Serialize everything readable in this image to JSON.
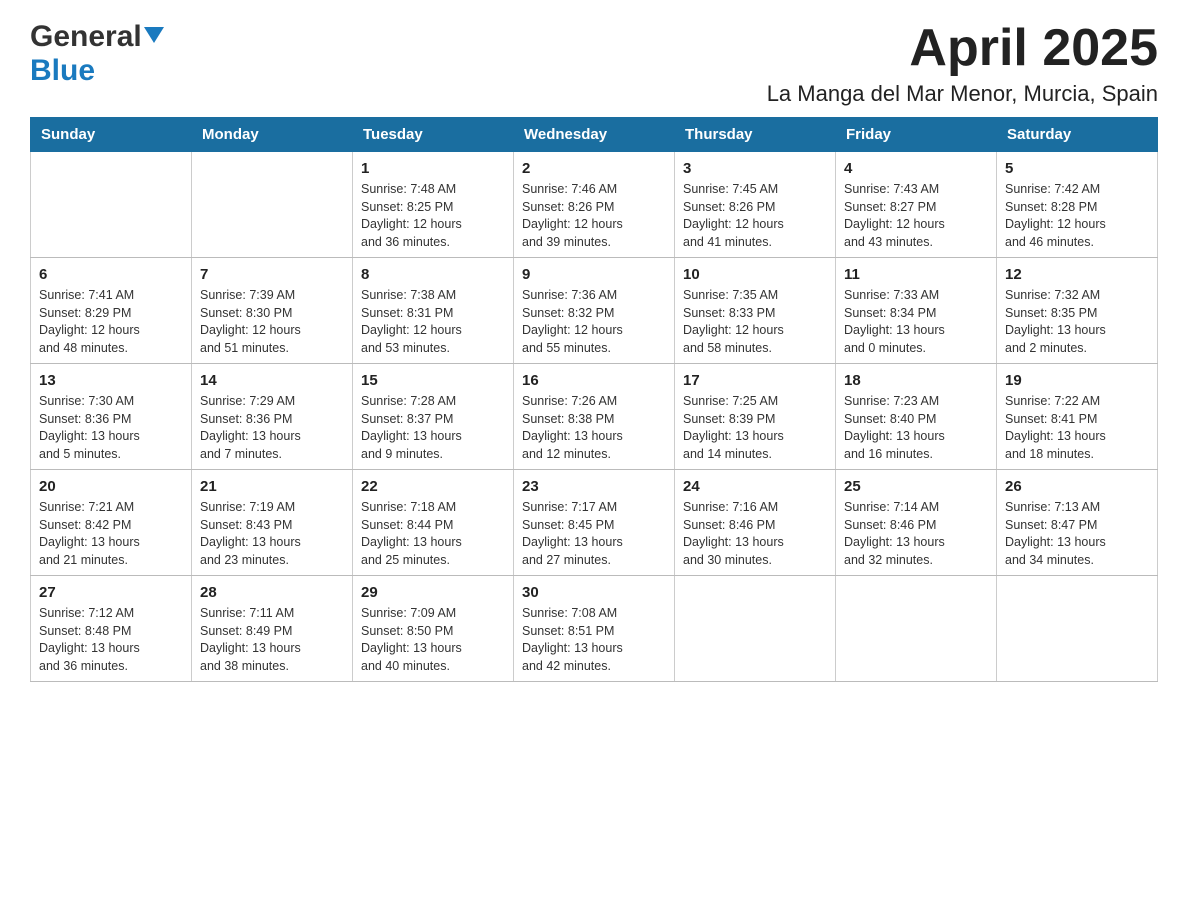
{
  "logo": {
    "general": "General",
    "blue": "Blue"
  },
  "title": "April 2025",
  "subtitle": "La Manga del Mar Menor, Murcia, Spain",
  "weekdays": [
    "Sunday",
    "Monday",
    "Tuesday",
    "Wednesday",
    "Thursday",
    "Friday",
    "Saturday"
  ],
  "rows": [
    [
      {
        "day": "",
        "info": ""
      },
      {
        "day": "",
        "info": ""
      },
      {
        "day": "1",
        "info": "Sunrise: 7:48 AM\nSunset: 8:25 PM\nDaylight: 12 hours\nand 36 minutes."
      },
      {
        "day": "2",
        "info": "Sunrise: 7:46 AM\nSunset: 8:26 PM\nDaylight: 12 hours\nand 39 minutes."
      },
      {
        "day": "3",
        "info": "Sunrise: 7:45 AM\nSunset: 8:26 PM\nDaylight: 12 hours\nand 41 minutes."
      },
      {
        "day": "4",
        "info": "Sunrise: 7:43 AM\nSunset: 8:27 PM\nDaylight: 12 hours\nand 43 minutes."
      },
      {
        "day": "5",
        "info": "Sunrise: 7:42 AM\nSunset: 8:28 PM\nDaylight: 12 hours\nand 46 minutes."
      }
    ],
    [
      {
        "day": "6",
        "info": "Sunrise: 7:41 AM\nSunset: 8:29 PM\nDaylight: 12 hours\nand 48 minutes."
      },
      {
        "day": "7",
        "info": "Sunrise: 7:39 AM\nSunset: 8:30 PM\nDaylight: 12 hours\nand 51 minutes."
      },
      {
        "day": "8",
        "info": "Sunrise: 7:38 AM\nSunset: 8:31 PM\nDaylight: 12 hours\nand 53 minutes."
      },
      {
        "day": "9",
        "info": "Sunrise: 7:36 AM\nSunset: 8:32 PM\nDaylight: 12 hours\nand 55 minutes."
      },
      {
        "day": "10",
        "info": "Sunrise: 7:35 AM\nSunset: 8:33 PM\nDaylight: 12 hours\nand 58 minutes."
      },
      {
        "day": "11",
        "info": "Sunrise: 7:33 AM\nSunset: 8:34 PM\nDaylight: 13 hours\nand 0 minutes."
      },
      {
        "day": "12",
        "info": "Sunrise: 7:32 AM\nSunset: 8:35 PM\nDaylight: 13 hours\nand 2 minutes."
      }
    ],
    [
      {
        "day": "13",
        "info": "Sunrise: 7:30 AM\nSunset: 8:36 PM\nDaylight: 13 hours\nand 5 minutes."
      },
      {
        "day": "14",
        "info": "Sunrise: 7:29 AM\nSunset: 8:36 PM\nDaylight: 13 hours\nand 7 minutes."
      },
      {
        "day": "15",
        "info": "Sunrise: 7:28 AM\nSunset: 8:37 PM\nDaylight: 13 hours\nand 9 minutes."
      },
      {
        "day": "16",
        "info": "Sunrise: 7:26 AM\nSunset: 8:38 PM\nDaylight: 13 hours\nand 12 minutes."
      },
      {
        "day": "17",
        "info": "Sunrise: 7:25 AM\nSunset: 8:39 PM\nDaylight: 13 hours\nand 14 minutes."
      },
      {
        "day": "18",
        "info": "Sunrise: 7:23 AM\nSunset: 8:40 PM\nDaylight: 13 hours\nand 16 minutes."
      },
      {
        "day": "19",
        "info": "Sunrise: 7:22 AM\nSunset: 8:41 PM\nDaylight: 13 hours\nand 18 minutes."
      }
    ],
    [
      {
        "day": "20",
        "info": "Sunrise: 7:21 AM\nSunset: 8:42 PM\nDaylight: 13 hours\nand 21 minutes."
      },
      {
        "day": "21",
        "info": "Sunrise: 7:19 AM\nSunset: 8:43 PM\nDaylight: 13 hours\nand 23 minutes."
      },
      {
        "day": "22",
        "info": "Sunrise: 7:18 AM\nSunset: 8:44 PM\nDaylight: 13 hours\nand 25 minutes."
      },
      {
        "day": "23",
        "info": "Sunrise: 7:17 AM\nSunset: 8:45 PM\nDaylight: 13 hours\nand 27 minutes."
      },
      {
        "day": "24",
        "info": "Sunrise: 7:16 AM\nSunset: 8:46 PM\nDaylight: 13 hours\nand 30 minutes."
      },
      {
        "day": "25",
        "info": "Sunrise: 7:14 AM\nSunset: 8:46 PM\nDaylight: 13 hours\nand 32 minutes."
      },
      {
        "day": "26",
        "info": "Sunrise: 7:13 AM\nSunset: 8:47 PM\nDaylight: 13 hours\nand 34 minutes."
      }
    ],
    [
      {
        "day": "27",
        "info": "Sunrise: 7:12 AM\nSunset: 8:48 PM\nDaylight: 13 hours\nand 36 minutes."
      },
      {
        "day": "28",
        "info": "Sunrise: 7:11 AM\nSunset: 8:49 PM\nDaylight: 13 hours\nand 38 minutes."
      },
      {
        "day": "29",
        "info": "Sunrise: 7:09 AM\nSunset: 8:50 PM\nDaylight: 13 hours\nand 40 minutes."
      },
      {
        "day": "30",
        "info": "Sunrise: 7:08 AM\nSunset: 8:51 PM\nDaylight: 13 hours\nand 42 minutes."
      },
      {
        "day": "",
        "info": ""
      },
      {
        "day": "",
        "info": ""
      },
      {
        "day": "",
        "info": ""
      }
    ]
  ]
}
